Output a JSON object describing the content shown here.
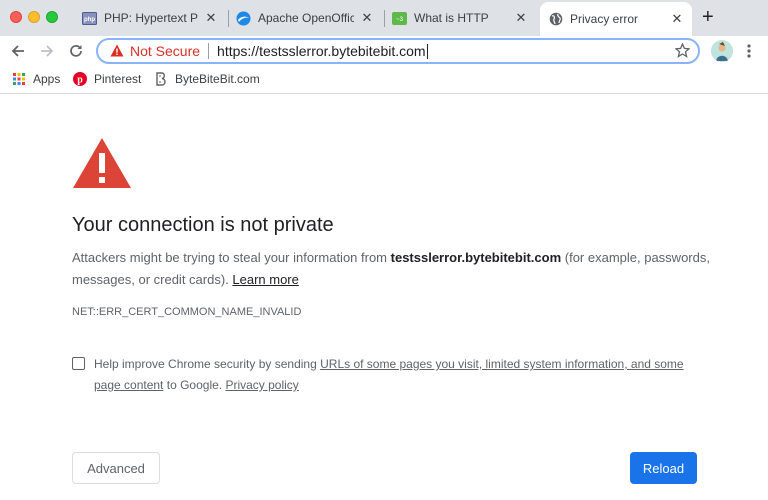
{
  "tabs": [
    {
      "title": "PHP: Hypertext Prep",
      "icon": "php-icon",
      "close": "✕"
    },
    {
      "title": "Apache OpenOffice",
      "icon": "openoffice-icon",
      "close": "✕"
    },
    {
      "title": "What is HTTP",
      "icon": "http-icon",
      "close": "✕"
    },
    {
      "title": "Privacy error",
      "icon": "globe-icon",
      "close": "✕",
      "active": true
    }
  ],
  "new_tab": "+",
  "omnibox": {
    "security_label": "Not Secure",
    "url": "https://testsslerror.bytebitebit.com"
  },
  "bookmarks": [
    {
      "label": "Apps",
      "icon": "apps-grid-icon"
    },
    {
      "label": "Pinterest",
      "icon": "pinterest-icon"
    },
    {
      "label": "ByteBiteBit.com",
      "icon": "bytebitebit-icon"
    }
  ],
  "interstitial": {
    "heading": "Your connection is not private",
    "explain_before": "Attackers might be trying to steal your information from ",
    "host": "testsslerror.bytebitebit.com",
    "explain_after": " (for example, passwords, messages, or credit cards). ",
    "learn_more": "Learn more",
    "error_code": "NET::ERR_CERT_COMMON_NAME_INVALID",
    "optin_before": "Help improve Chrome security by sending ",
    "optin_link": "URLs of some pages you visit, limited system information, and some page content",
    "optin_middle": " to Google. ",
    "privacy_policy": "Privacy policy",
    "advanced_button": "Advanced",
    "reload_button": "Reload"
  },
  "colors": {
    "alert_red": "#db4437",
    "not_secure_red": "#d93025",
    "reload_blue": "#1a73e8",
    "omnibox_focus": "#8ab4f8"
  }
}
